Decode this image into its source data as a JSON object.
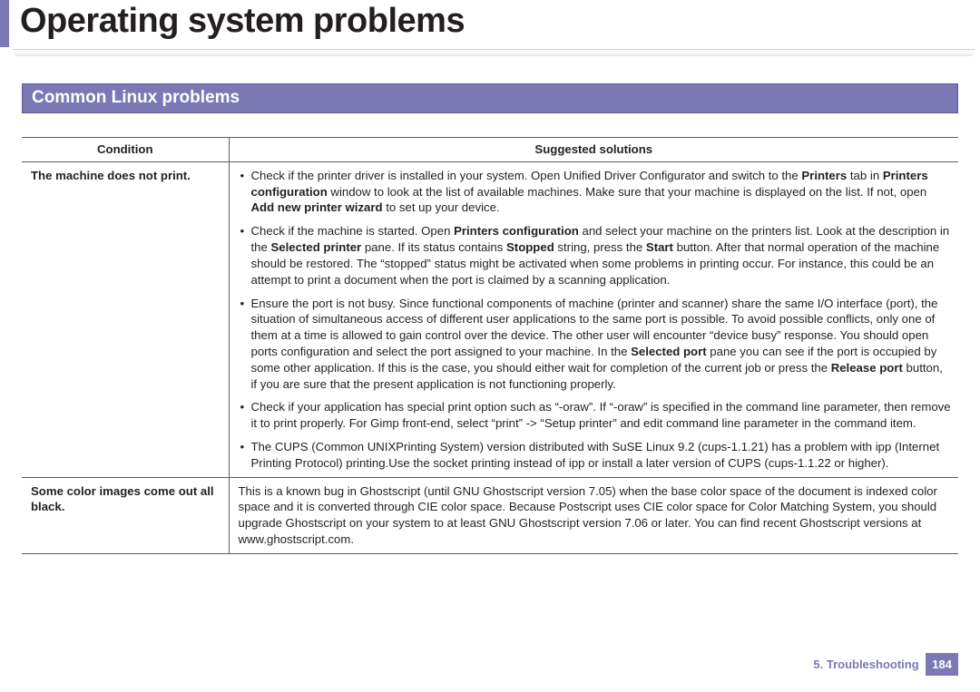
{
  "page_title": "Operating system problems",
  "section_heading": "Common Linux problems",
  "table": {
    "headers": {
      "condition": "Condition",
      "solutions": "Suggested solutions"
    },
    "rows": [
      {
        "condition": "The machine does not print.",
        "bullets": {
          "b1": {
            "p1": "Check if the printer driver is installed in your system. Open Unified Driver Configurator and switch to the ",
            "bold1": "Printers",
            "p2": " tab in ",
            "bold2": "Printers configuration",
            "p3": " window to look at the list of available machines. Make sure that your machine is displayed on the list. If not, open ",
            "bold3": "Add new printer wizard",
            "p4": " to set up your device."
          },
          "b2": {
            "p1": "Check if the machine is started. Open ",
            "bold1": "Printers configuration",
            "p2": " and select your machine on the printers list. Look at the description in the ",
            "bold2": "Selected printer",
            "p3": " pane. If its status contains ",
            "bold3": "Stopped",
            "p4": " string, press the ",
            "bold4": "Start",
            "p5": " button. After that normal operation of the machine should be restored. The “stopped” status might be activated when some problems in printing occur. For instance, this could be an attempt to print a document when the port is claimed by a scanning application."
          },
          "b3": {
            "p1": "Ensure the port is not busy. Since functional components of machine (printer and scanner) share the same I/O interface (port), the situation of simultaneous access of different user applications to the same port is possible. To avoid possible conflicts, only one of them at a time is allowed to gain control over the device. The other user will encounter “device busy” response. You should open ports configuration and select the port assigned to your machine. In the ",
            "bold1": "Selected port",
            "p2": " pane you can see if the port is occupied by some other application. If this is the case, you should either wait for completion of the current job or press the ",
            "bold2": "Release port",
            "p3": " button, if you are sure that the present application is not functioning properly."
          },
          "b4": {
            "p1": "Check if your application has special print option such as “-oraw”. If “-oraw” is specified in the command line parameter, then remove it to print properly. For Gimp front-end, select “print” -> “Setup printer” and edit command line parameter in the command item."
          },
          "b5": {
            "p1": "The CUPS (Common UNIXPrinting System) version distributed with SuSE Linux 9.2 (cups-1.1.21) has a problem with ipp (Internet Printing Protocol) printing.Use the socket printing instead of ipp or install a later version of CUPS (cups-1.1.22 or higher)."
          }
        }
      },
      {
        "condition": "Some color images come out all black.",
        "text": "This is a known bug in Ghostscript (until GNU Ghostscript version 7.05) when the base color space of the document is indexed color space and it is converted through CIE color space. Because Postscript uses CIE color space for Color Matching System, you should upgrade Ghostscript on your system to at least GNU Ghostscript version 7.06 or later. You can find recent Ghostscript versions at www.ghostscript.com."
      }
    ]
  },
  "footer": {
    "chapter": "5.  Troubleshooting",
    "page": "184"
  }
}
